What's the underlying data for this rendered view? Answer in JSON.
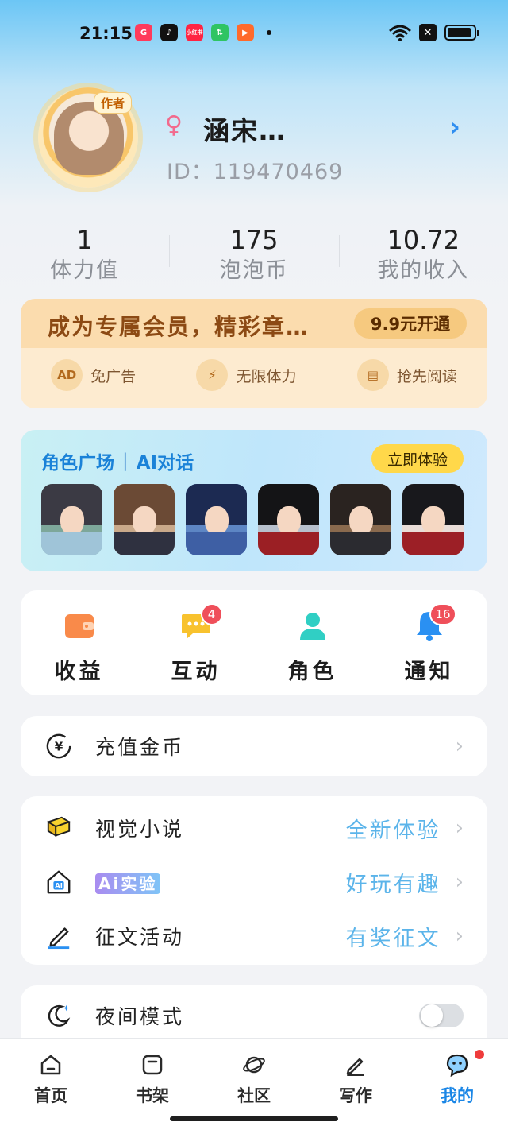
{
  "status_bar": {
    "time": "21:15",
    "apps": [
      {
        "name": "shopping-app-icon",
        "color": "#ff3b5b",
        "glyph": "G"
      },
      {
        "name": "tiktok-icon",
        "color": "#111111",
        "glyph": "♪"
      },
      {
        "name": "xiaohongshu-icon",
        "color": "#ff2442",
        "glyph": "小红书"
      },
      {
        "name": "wechat-mini-icon",
        "color": "#2fc463",
        "glyph": "⇅"
      },
      {
        "name": "video-app-icon",
        "color": "#ff6a2b",
        "glyph": "▶"
      }
    ],
    "xbox_glyph": "✕"
  },
  "profile": {
    "author_badge": "作者",
    "gender_symbol": "♀",
    "username": "涵宋…",
    "user_id": "ID：119470469",
    "arrow": "›"
  },
  "stats": [
    {
      "value": "1",
      "label": "体力值"
    },
    {
      "value": "175",
      "label": "泡泡币"
    },
    {
      "value": "10.72",
      "label": "我的收入"
    }
  ],
  "vip": {
    "title": "成为专属会员，精彩章…",
    "button": "9.9元开通",
    "perks": [
      {
        "icon": "ad-icon",
        "glyph": "AD",
        "label": "免广告"
      },
      {
        "icon": "lightning-icon",
        "glyph": "⚡",
        "label": "无限体力"
      },
      {
        "icon": "book-icon",
        "glyph": "▤",
        "label": "抢先阅读"
      }
    ]
  },
  "ai_card": {
    "title_left": "角色广场",
    "separator": "|",
    "title_right": "AI对话",
    "button": "立即体验",
    "characters": [
      {
        "hair": "#3b3a44",
        "body": "#9fc4d8",
        "bg": "#7da79a"
      },
      {
        "hair": "#6b4a35",
        "body": "#2f3140",
        "bg": "#c9a98a"
      },
      {
        "hair": "#1c2a52",
        "body": "#3e5fa4",
        "bg": "#5d86c4"
      },
      {
        "hair": "#141416",
        "body": "#9b1f24",
        "bg": "#b7c0cc"
      },
      {
        "hair": "#2a2320",
        "body": "#2b2b30",
        "bg": "#8a6a4e"
      },
      {
        "hair": "#18181c",
        "body": "#9c1f26",
        "bg": "#e9ddd8"
      }
    ]
  },
  "quick_actions": [
    {
      "name": "earnings",
      "label": "收益",
      "icon": "wallet-icon",
      "badge": ""
    },
    {
      "name": "interaction",
      "label": "互动",
      "icon": "chat-bubble-icon",
      "badge": "4"
    },
    {
      "name": "character",
      "label": "角色",
      "icon": "person-icon",
      "badge": ""
    },
    {
      "name": "notification",
      "label": "通知",
      "icon": "bell-icon",
      "badge": "16"
    }
  ],
  "recharge": {
    "label": "充值金币",
    "icon": "yuan-coin-icon",
    "glyph": "¥"
  },
  "features": [
    {
      "name": "visual-novel",
      "label": "视觉小说",
      "extra": "全新体验",
      "icon": "book-icon"
    },
    {
      "name": "ai-lab",
      "label": "Ai实验",
      "extra": "好玩有趣",
      "icon": "ai-home-icon"
    },
    {
      "name": "writing-contest",
      "label": "征文活动",
      "extra": "有奖征文",
      "icon": "pencil-icon"
    }
  ],
  "night_mode": {
    "label": "夜间模式",
    "icon": "moon-icon",
    "enabled": false
  },
  "chevron": "›",
  "tabs": [
    {
      "name": "home",
      "label": "首页",
      "icon": "home-icon",
      "active": false
    },
    {
      "name": "bookshelf",
      "label": "书架",
      "icon": "bookshelf-icon",
      "active": false
    },
    {
      "name": "community",
      "label": "社区",
      "icon": "planet-icon",
      "active": false
    },
    {
      "name": "write",
      "label": "写作",
      "icon": "pen-icon",
      "active": false
    },
    {
      "name": "mine",
      "label": "我的",
      "icon": "profile-chat-icon",
      "active": true
    }
  ],
  "colors": {
    "accent": "#1a86e6",
    "badge": "#ef4f5a",
    "vip_text": "#8c4a14"
  }
}
